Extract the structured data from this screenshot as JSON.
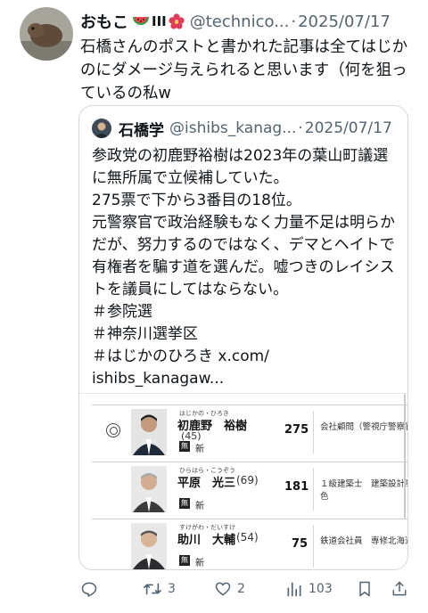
{
  "tweet": {
    "display_name": "おもこ",
    "handle": "@technico...",
    "separator": "·",
    "date": "2025/07/17",
    "text": "石橋さんのポストと書かれた記事は全てはじかのにダメージ与えられると思います（何を狙っているの私w"
  },
  "quote": {
    "display_name": "石橋学",
    "handle": "@ishibs_kanag...",
    "separator": "·",
    "date": "2025/07/17",
    "lines": [
      "参政党の初鹿野裕樹は2023年の葉山町議選に無所属で立候補していた。",
      "275票で下から3番目の18位。",
      "元警察官で政治経験もなく力量不足は明らかだが、努力するのではなく、デマとヘイトで有権者を騙す道を選んだ。嘘つきのレイシストを議員にしてはならない。",
      "＃参院選",
      "＃神奈川選挙区",
      "＃はじかのひろき x.com/",
      "ishibs_kanagaw..."
    ],
    "candidates": [
      {
        "kana": "はじかの・ひろき",
        "name": "初鹿野　裕樹",
        "age": "(45)",
        "party_mark": "無",
        "status": "新",
        "votes": "275",
        "job": "会社顧問（警視庁警察官）"
      },
      {
        "kana": "ひらはら・こうぞう",
        "name": "平原　光三",
        "age": "(69)",
        "party_mark": "無",
        "status": "新",
        "votes": "181",
        "job": "１級建築士　建築設計事務\n色"
      },
      {
        "kana": "すけがわ・だいすけ",
        "name": "助川　大輔",
        "age": "(54)",
        "party_mark": "無",
        "status": "新",
        "votes": "75",
        "job": "鉄道会社員　専修北海道職"
      }
    ]
  },
  "actions": {
    "retweets": "3",
    "likes": "2",
    "views": "103"
  },
  "icons": [
    "watermelon-emoji",
    "hibiscus-emoji",
    "reply-icon",
    "retweet-icon",
    "heart-icon",
    "views-icon",
    "bookmark-icon",
    "share-icon",
    "radio-circle-icon"
  ],
  "colors": {
    "text": "#0f1419",
    "muted": "#536471",
    "border": "#cfd9de"
  }
}
